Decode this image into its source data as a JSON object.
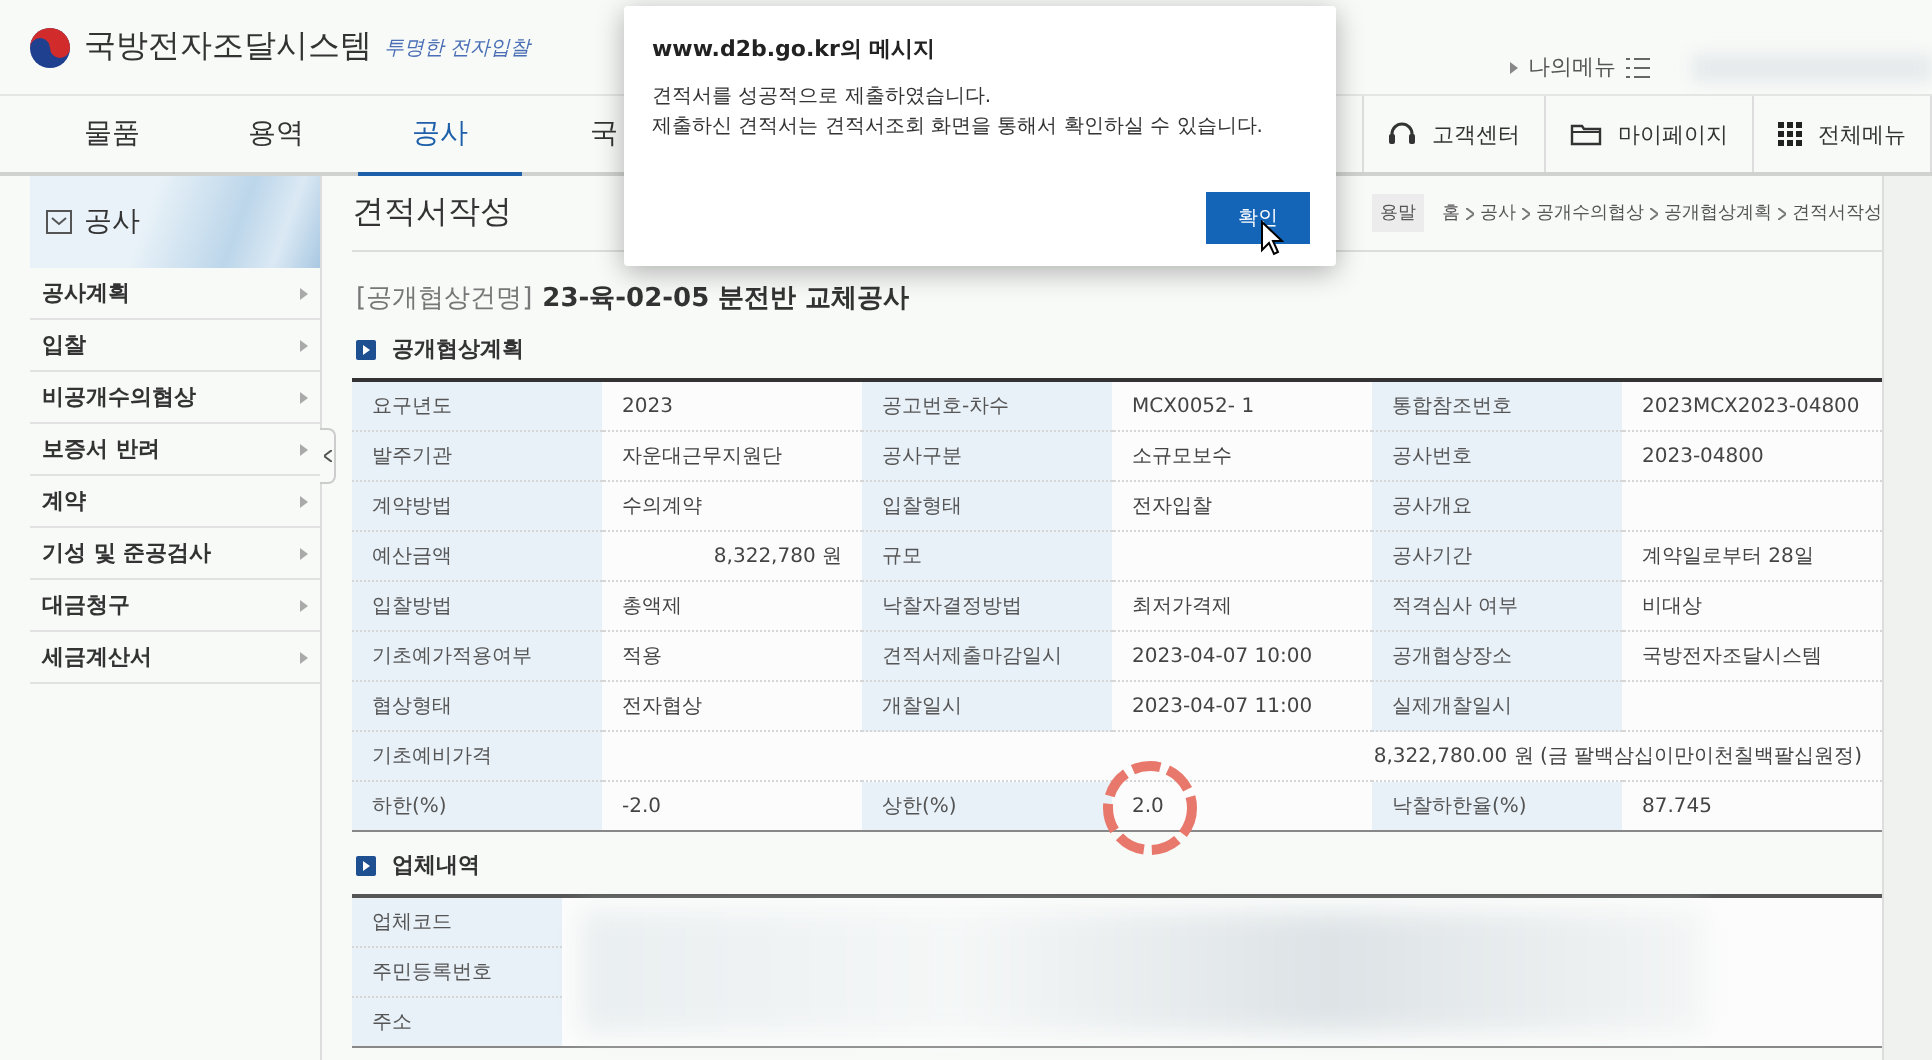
{
  "header": {
    "logo_text": "국방전자조달시스템",
    "slogan": "투명한 전자입찰",
    "my_menu": "나의메뉴"
  },
  "nav": {
    "tabs": [
      {
        "label": "물품",
        "selected": false
      },
      {
        "label": "용역",
        "selected": false
      },
      {
        "label": "공사",
        "selected": true
      },
      {
        "label": "국",
        "selected": false
      }
    ],
    "utilities": [
      {
        "kind": "headset",
        "label": "고객센터"
      },
      {
        "kind": "folder",
        "label": "마이페이지"
      },
      {
        "kind": "grid",
        "label": "전체메뉴"
      }
    ]
  },
  "sidebar": {
    "title": "공사",
    "items": [
      "공사계획",
      "입찰",
      "비공개수의협상",
      "보증서 반려",
      "계약",
      "기성 및 준공검사",
      "대금청구",
      "세금계산서"
    ]
  },
  "page": {
    "title": "견적서작성",
    "help_fragment": "용말",
    "breadcrumb": [
      "홈",
      "공사",
      "공개수의협상",
      "공개협상계획",
      "견적서작성"
    ],
    "case_prefix": "[공개협상건명]",
    "case_name": "23-육-02-05 분전반 교체공사"
  },
  "plan": {
    "heading": "공개협상계획",
    "rows": [
      [
        {
          "label": "요구년도",
          "value": "2023"
        },
        {
          "label": "공고번호-차수",
          "value": "MCX0052- 1"
        },
        {
          "label": "통합참조번호",
          "value": "2023MCX2023-04800"
        }
      ],
      [
        {
          "label": "발주기관",
          "value": "자운대근무지원단"
        },
        {
          "label": "공사구분",
          "value": "소규모보수"
        },
        {
          "label": "공사번호",
          "value": "2023-04800"
        }
      ],
      [
        {
          "label": "계약방법",
          "value": "수의계약"
        },
        {
          "label": "입찰형태",
          "value": "전자입찰"
        },
        {
          "label": "공사개요"
        }
      ],
      [
        {
          "label": "예산금액",
          "value": "8,322,780 원",
          "kind": "amount"
        },
        {
          "label": "규모"
        },
        {
          "label": "공사기간",
          "value": "계약일로부터 28일"
        }
      ],
      [
        {
          "label": "입찰방법",
          "value": "총액제"
        },
        {
          "label": "낙찰자결정방법",
          "value": "최저가격제"
        },
        {
          "label": "적격심사 여부",
          "value": "비대상"
        }
      ],
      [
        {
          "label": "기초예가적용여부",
          "value": "적용"
        },
        {
          "label": "견적서제출마감일시",
          "value": "2023-04-07 10:00"
        },
        {
          "label": "공개협상장소",
          "value": "국방전자조달시스템"
        }
      ],
      [
        {
          "label": "협상형태",
          "value": "전자협상"
        },
        {
          "label": "개찰일시",
          "value": "2023-04-07 11:00"
        },
        {
          "label": "실제개찰일시"
        }
      ],
      [
        {
          "label": "기초예비가격",
          "value": "8,322,780.00 원 (금 팔백삼십이만이천칠백팔십원정)",
          "kind": "wide"
        }
      ],
      [
        {
          "label": "하한(%)",
          "value": "-2.0"
        },
        {
          "label": "상한(%)",
          "value": "2.0",
          "circled": true
        },
        {
          "label": "낙찰하한율(%)",
          "value": "87.745"
        }
      ]
    ]
  },
  "company": {
    "heading": "업체내역",
    "blurred": true,
    "labels": [
      "업체코드",
      "주민등록번호",
      "주소"
    ]
  },
  "dialog": {
    "title": "www.d2b.go.kr의 메시지",
    "lines": [
      "견적서를 성공적으로  제출하였습니다.",
      "제출하신 견적서는 견적서조회 화면을 통해서 확인하실 수 있습니다."
    ],
    "button": "확인"
  }
}
